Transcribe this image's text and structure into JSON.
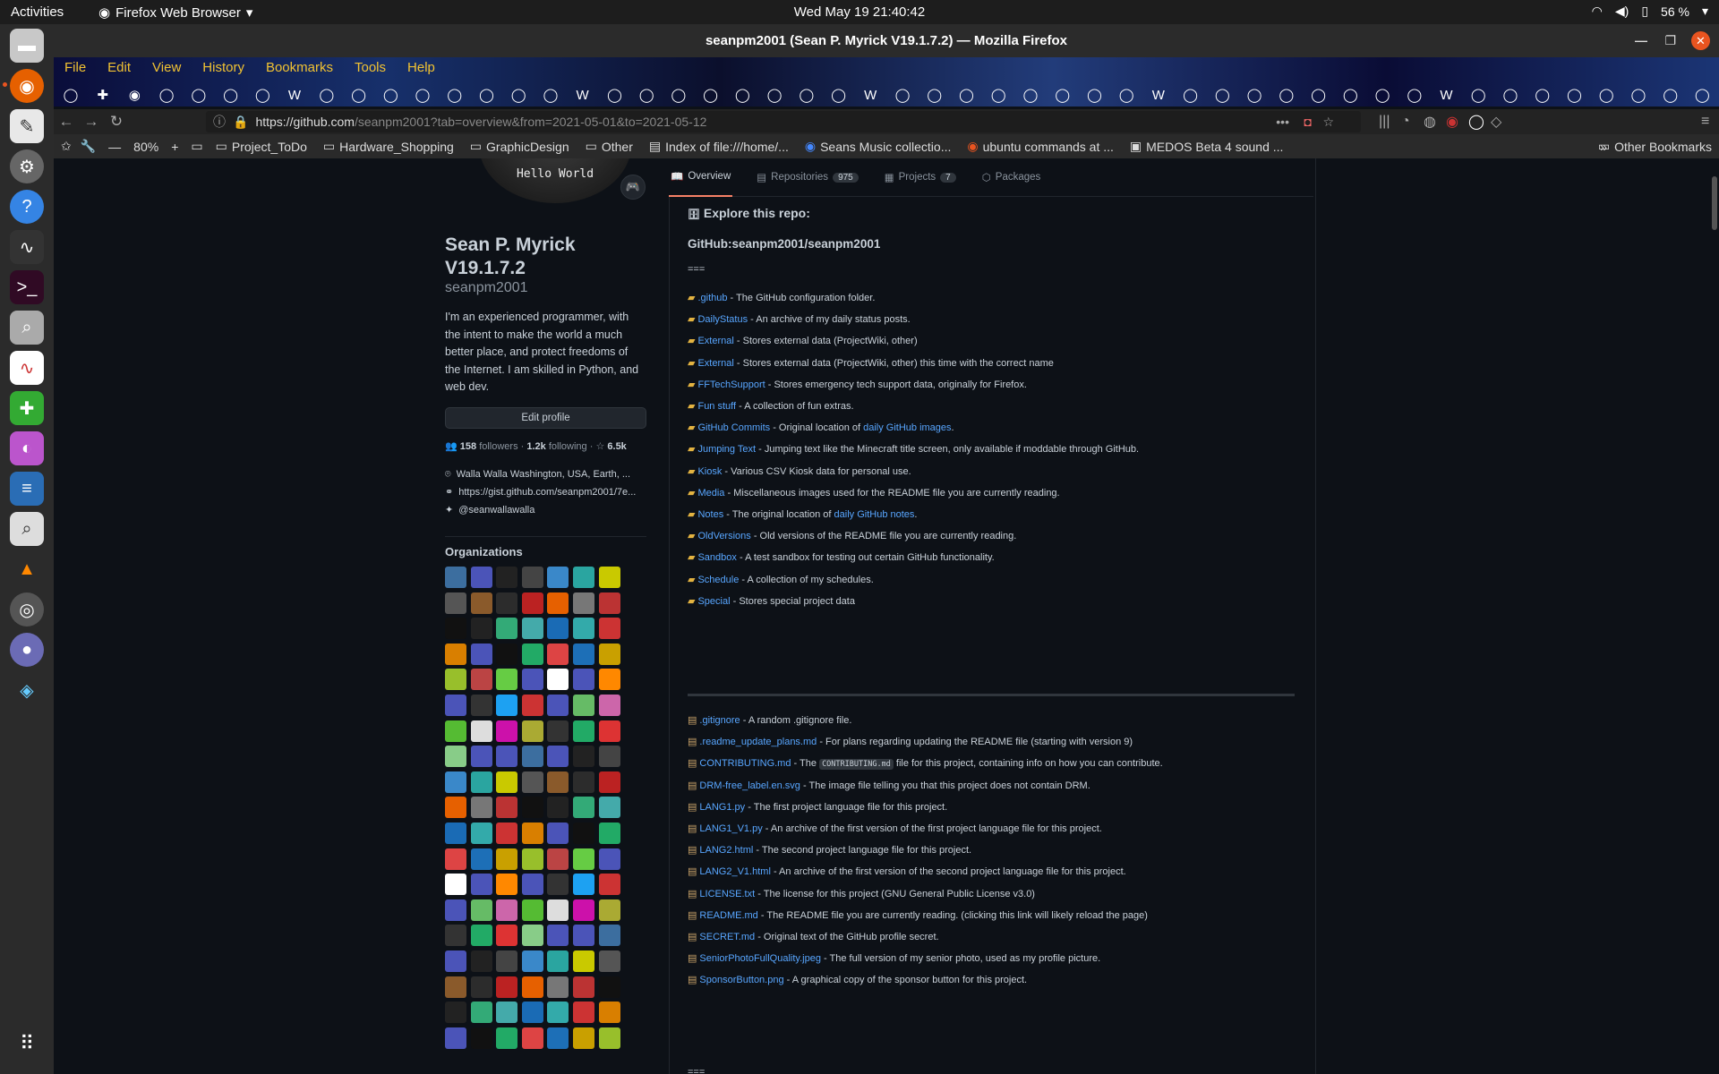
{
  "topbar": {
    "activities": "Activities",
    "app_name": "Firefox Web Browser",
    "clock": "Wed May 19  21:40:42",
    "battery": "56 %"
  },
  "window": {
    "title": "seanpm2001 (Sean P. Myrick V19.1.7.2) — Mozilla Firefox"
  },
  "menu": [
    "File",
    "Edit",
    "View",
    "History",
    "Bookmarks",
    "Tools",
    "Help"
  ],
  "navbar": {
    "url_host": "https://github.com",
    "url_path": "/seanpm2001?tab=overview&from=2021-05-01&to=2021-05-12"
  },
  "bookmarks_bar": {
    "zoom": "80%",
    "items": [
      "Project_ToDo",
      "Hardware_Shopping",
      "GraphicDesign",
      "Other",
      "Index of file:///home/...",
      "Seans Music collectio...",
      "ubuntu commands at ...",
      "MEDOS Beta 4 sound ..."
    ],
    "other": "Other Bookmarks"
  },
  "profile": {
    "avatar_text": "Hello World",
    "status_emoji": "🎮",
    "name": "Sean P. Myrick V19.1.7.2",
    "login": "seanpm2001",
    "bio": "I'm an experienced programmer, with the intent to make the world a much better place, and protect freedoms of the Internet. I am skilled in Python, and web dev.",
    "edit_button": "Edit profile",
    "followers_count": "158",
    "followers_label": "followers",
    "following_count": "1.2k",
    "following_label": "following",
    "stars": "6.5k",
    "location": "Walla Walla Washington, USA, Earth, ...",
    "website": "https://gist.github.com/seanpm2001/7e...",
    "twitter": "@seanwallawalla",
    "orgs_title": "Organizations"
  },
  "tabs": [
    {
      "label": "Overview",
      "count": ""
    },
    {
      "label": "Repositories",
      "count": "975"
    },
    {
      "label": "Projects",
      "count": "7"
    },
    {
      "label": "Packages",
      "count": ""
    }
  ],
  "readme": {
    "explore": "Explore this repo:",
    "repo_title": "GitHub:seanpm2001/seanpm2001",
    "separator": "===",
    "folders": [
      {
        "name": ".github",
        "desc": " - The GitHub configuration folder."
      },
      {
        "name": "DailyStatus",
        "desc": " - An archive of my daily status posts."
      },
      {
        "name": "External",
        "desc": " - Stores external data (ProjectWiki, other)"
      },
      {
        "name": "External",
        "desc": " - Stores external data (ProjectWiki, other) this time with the correct name"
      },
      {
        "name": "FFTechSupport",
        "desc": " - Stores emergency tech support data, originally for Firefox."
      },
      {
        "name": "Fun stuff",
        "desc": " - A collection of fun extras."
      },
      {
        "name": "GitHub Commits",
        "desc": " - Original location of ",
        "link": "daily GitHub images",
        "tail": "."
      },
      {
        "name": "Jumping Text",
        "desc": " - Jumping text like the Minecraft title screen, only available if moddable through GitHub."
      },
      {
        "name": "Kiosk",
        "desc": " - Various CSV Kiosk data for personal use."
      },
      {
        "name": "Media",
        "desc": " - Miscellaneous images used for the README file you are currently reading."
      },
      {
        "name": "Notes",
        "desc": " - The original location of ",
        "link": "daily GitHub notes",
        "tail": "."
      },
      {
        "name": "OldVersions",
        "desc": " - Old versions of the README file you are currently reading."
      },
      {
        "name": "Sandbox",
        "desc": " - A test sandbox for testing out certain GitHub functionality."
      },
      {
        "name": "Schedule",
        "desc": " - A collection of my schedules."
      },
      {
        "name": "Special",
        "desc": " - Stores special project data"
      }
    ],
    "files": [
      {
        "name": ".gitignore",
        "desc": " - A random .gitignore file."
      },
      {
        "name": ".readme_update_plans.md",
        "desc": " - For plans regarding updating the README file (starting with version 9)"
      },
      {
        "name": "CONTRIBUTING.md",
        "desc": " - The ",
        "code": "CONTRIBUTING.md",
        "tail": " file for this project, containing info on how you can contribute."
      },
      {
        "name": "DRM-free_label.en.svg",
        "desc": " - The image file telling you that this project does not contain DRM."
      },
      {
        "name": "LANG1.py",
        "desc": " - The first project language file for this project."
      },
      {
        "name": "LANG1_V1.py",
        "desc": " - An archive of the first version of the first project language file for this project."
      },
      {
        "name": "LANG2.html",
        "desc": " - The second project language file for this project."
      },
      {
        "name": "LANG2_V1.html",
        "desc": " - An archive of the first version of the second project language file for this project."
      },
      {
        "name": "LICENSE.txt",
        "desc": " - The license for this project (GNU General Public License v3.0)"
      },
      {
        "name": "README.md",
        "desc": " - The README file you are currently reading. (clicking this link will likely reload the page)"
      },
      {
        "name": "SECRET.md",
        "desc": " - Original text of the GitHub profile secret."
      },
      {
        "name": "SeniorPhotoFullQuality.jpeg",
        "desc": " - The full version of my senior photo, used as my profile picture."
      },
      {
        "name": "SponsorButton.png",
        "desc": " - A graphical copy of the sponsor button for this project."
      }
    ],
    "end_separator": "==="
  },
  "org_colors": [
    "#3c6e9f",
    "#4b54b8",
    "#222",
    "#444",
    "#3a88c9",
    "#2aa5a0",
    "#c9c900",
    "#555",
    "#8a5a2b",
    "#2c2c2c",
    "#b22",
    "#e66000",
    "#777",
    "#b33",
    "#111",
    "#222",
    "#3a7",
    "#4aa",
    "#1a6bb5",
    "#3aa",
    "#c33",
    "#d97f00",
    "#4b54b8",
    "#111",
    "#2a6",
    "#d44",
    "#1d6fb7",
    "#c9a000",
    "#98bf2b",
    "#b44",
    "#6c4",
    "#4b54b8",
    "#fff",
    "#4b54b8",
    "#f80",
    "#4b54b8",
    "#333",
    "#1da1f2",
    "#c33",
    "#4b54b8",
    "#6b6",
    "#c6a",
    "#5b3",
    "#ddd",
    "#c1a",
    "#aa3",
    "#333",
    "#2a6",
    "#d33",
    "#8c8",
    "#4b54b8",
    "#4b54b8"
  ]
}
